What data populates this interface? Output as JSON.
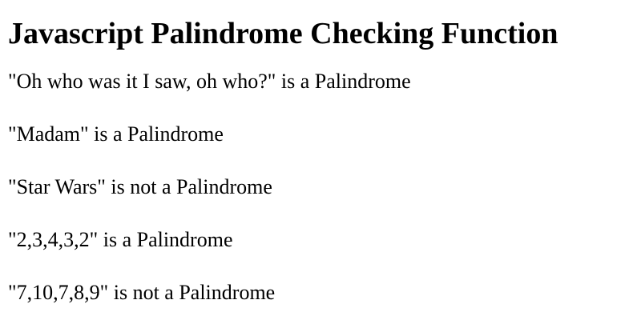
{
  "page": {
    "title": "Javascript Palindrome Checking Function",
    "results": [
      "\"Oh who was it I saw, oh who?\" is a Palindrome",
      "\"Madam\" is a Palindrome",
      "\"Star Wars\" is not a Palindrome",
      "\"2,3,4,3,2\" is a Palindrome",
      "\"7,10,7,8,9\" is not a Palindrome"
    ]
  }
}
